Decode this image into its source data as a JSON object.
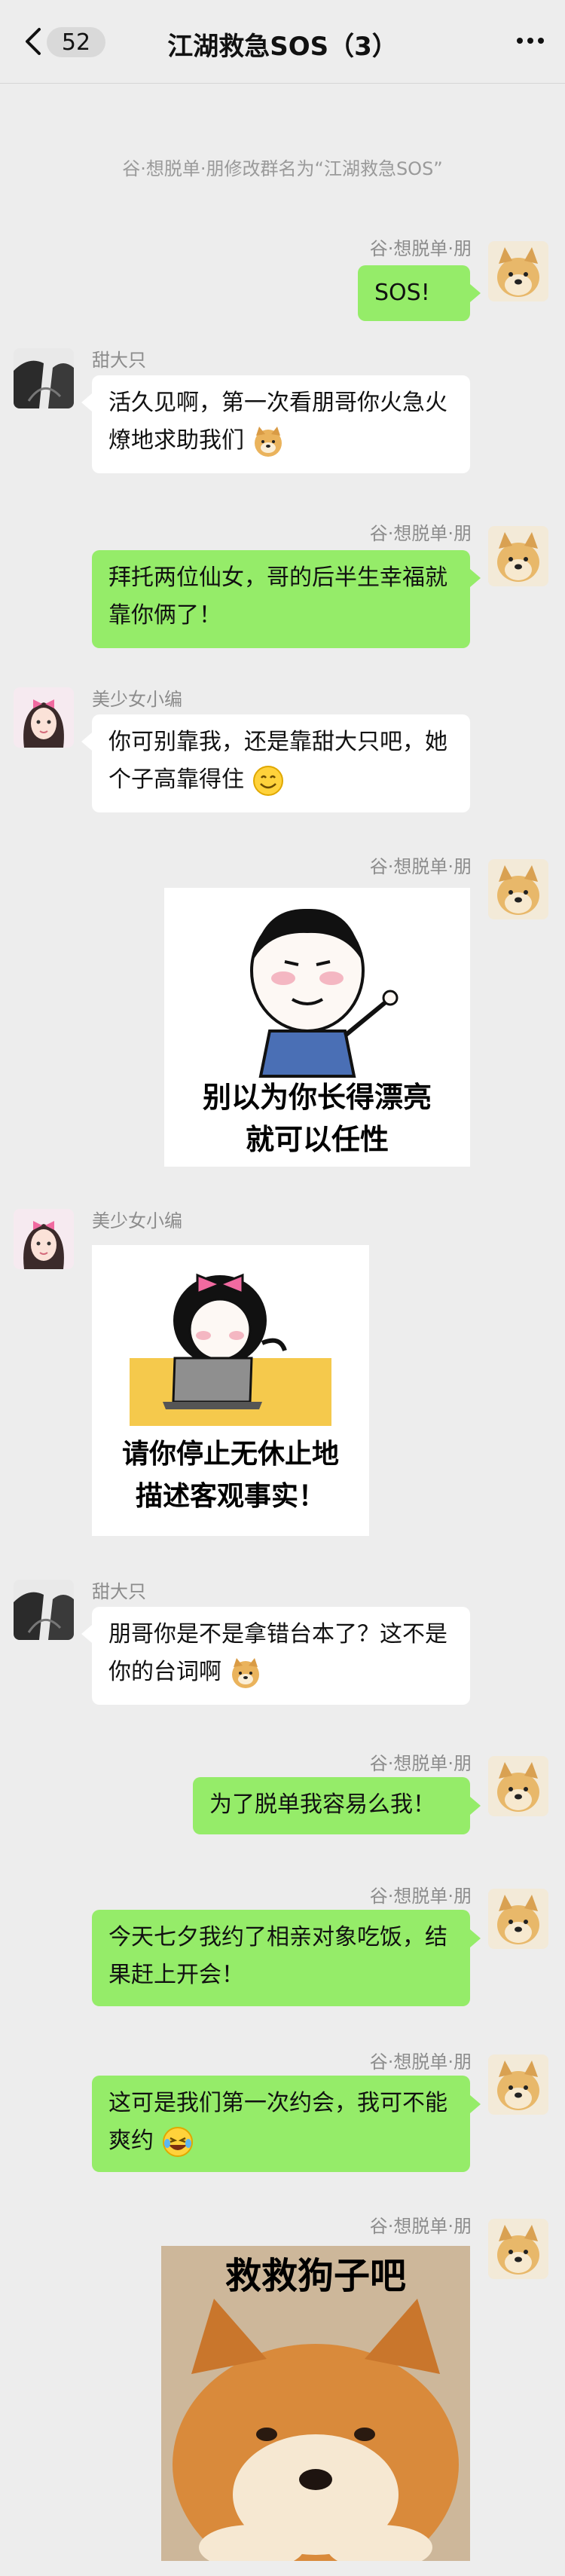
{
  "header": {
    "unread_count": "52",
    "title": "江湖救急SOS（3）"
  },
  "system_message": "谷·想脱单·朋修改群名为“江湖救急SOS”",
  "users": {
    "me": "谷·想脱单·朋",
    "tian": "甜大只",
    "mei": "美少女小编"
  },
  "messages": {
    "m1": "SOS!",
    "m2": "活久见啊，第一次看朋哥你火急火燎地求助我们",
    "m3": "拜托两位仙女，哥的后半生幸福就靠你俩了！",
    "m4": "你可别靠我，还是靠甜大只吧，她个子高靠得住",
    "m6_sticker_caption": [
      "别以为你长得漂亮",
      "就可以任性"
    ],
    "m7_sticker_caption": [
      "请你停止无休止地",
      "描述客观事实！"
    ],
    "m8": "朋哥你是不是拿错台本了？这不是你的台词啊",
    "m9": "为了脱单我容易么我！",
    "m10": "今天七夕我约了相亲对象吃饭，结果赶上开会！",
    "m11": "这可是我们第一次约会，我可不能爽约",
    "m12_sticker_caption": "救救狗子吧"
  },
  "colors": {
    "my_bubble": "#95ec69",
    "other_bubble": "#ffffff",
    "background": "#ededed"
  },
  "icons": {
    "back": "chevron-left-icon",
    "more": "more-dots-icon",
    "emoji_doge": "doge-emoji-icon",
    "emoji_smile": "smile-emoji-icon",
    "emoji_tears": "laughing-tears-emoji-icon"
  }
}
